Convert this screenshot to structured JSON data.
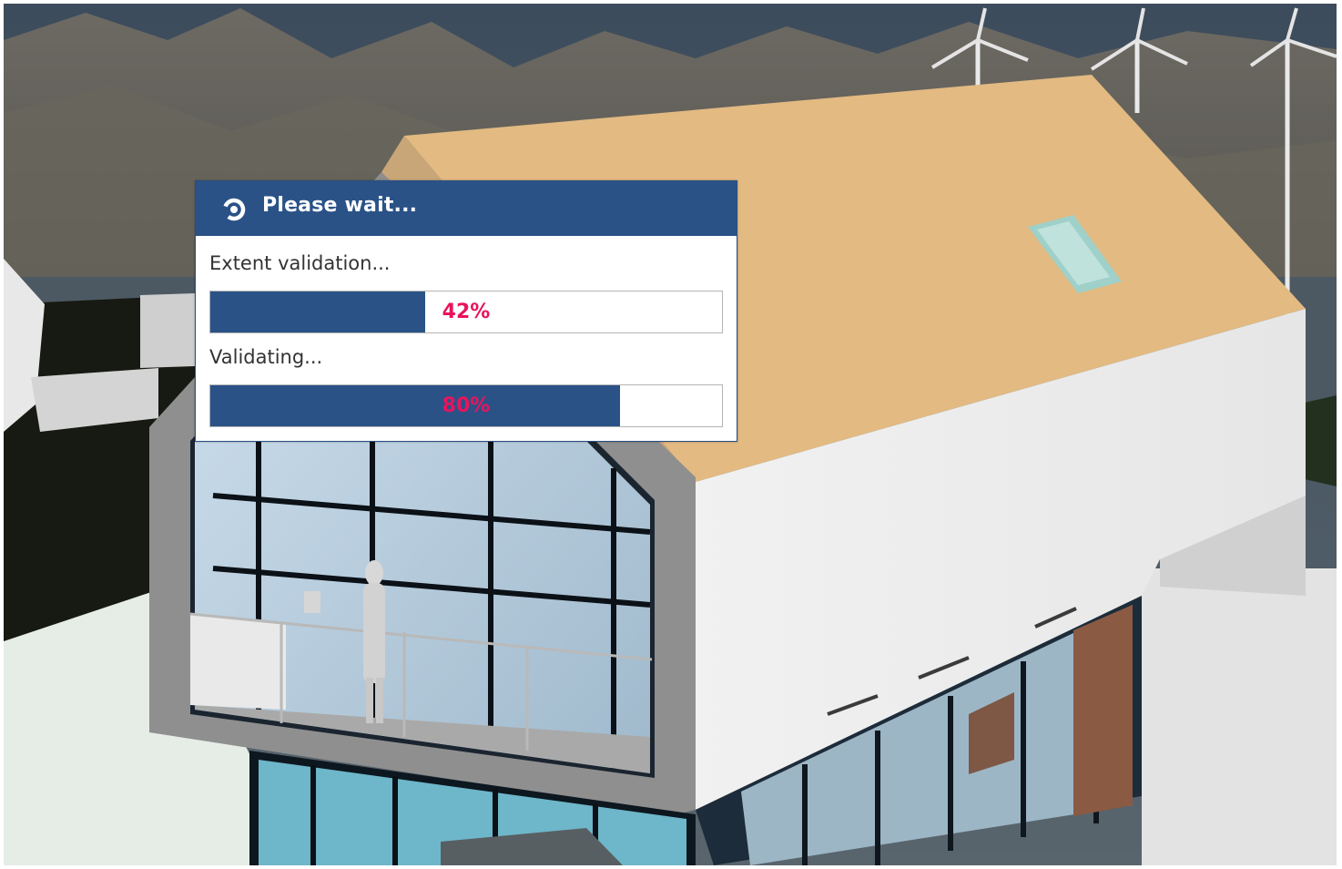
{
  "dialog": {
    "title": "Please wait...",
    "icon": "spinner-icon",
    "header_color": "#2a5287",
    "tasks": [
      {
        "label": "Extent validation...",
        "progress_text": "42%",
        "progress": 0.42
      },
      {
        "label": "Validating...",
        "progress_text": "80%",
        "progress": 0.8
      }
    ],
    "bar_fill_color": "#2a5287",
    "percent_text_color": "#e8145c"
  },
  "viewport": {
    "content": "3d-building-model"
  }
}
